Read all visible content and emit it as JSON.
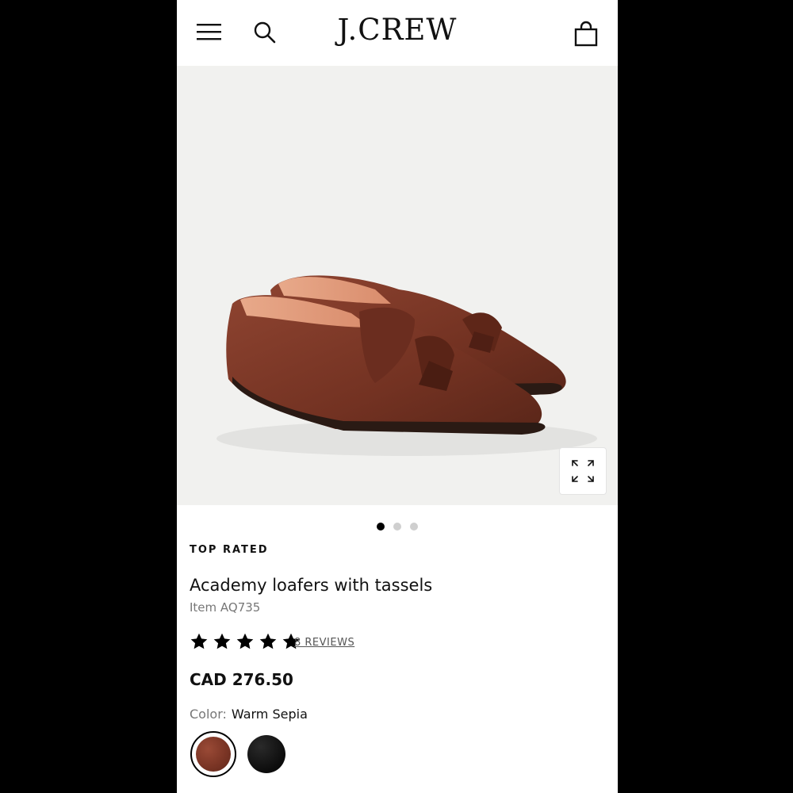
{
  "header": {
    "brand": "J.CREW",
    "icons": [
      "menu-icon",
      "search-icon",
      "shopping-bag-icon"
    ]
  },
  "gallery": {
    "image_alt": "Academy loafers with tassels in Warm Sepia",
    "slides_count": 3,
    "active_slide": 1,
    "expand_icon": "expand-icon"
  },
  "product": {
    "badge": "TOP RATED",
    "title": "Academy loafers with tassels",
    "item_number": "Item AQ735",
    "rating": 5,
    "reviews_link": "8 REVIEWS",
    "price": "CAD 276.50",
    "color_label": "Color:",
    "color_value": "Warm Sepia",
    "swatches": [
      {
        "name": "Warm Sepia",
        "color": "#7b3525",
        "selected": true
      },
      {
        "name": "Black",
        "color": "#111111",
        "selected": false
      }
    ]
  },
  "colors": {
    "accent": "#000000",
    "hero_background": "#f1f1ef",
    "leather": "#7b3525"
  }
}
